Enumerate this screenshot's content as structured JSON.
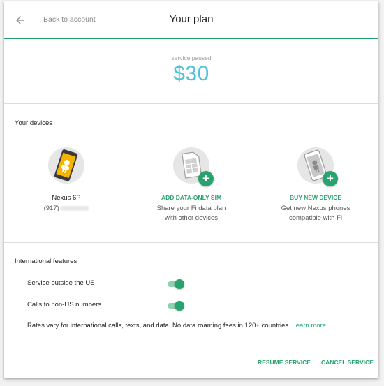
{
  "header": {
    "back_label": "Back to account",
    "title": "Your plan"
  },
  "plan": {
    "status": "service paused",
    "price": "$30"
  },
  "devices": {
    "section_title": "Your devices",
    "owned": {
      "name": "Nexus 6P",
      "number_prefix": "(917)"
    },
    "data_sim": {
      "action": "ADD DATA-ONLY SIM",
      "desc_line1": "Share your Fi data plan",
      "desc_line2": "with other devices"
    },
    "buy_device": {
      "action": "BUY NEW DEVICE",
      "desc_line1": "Get new Nexus phones",
      "desc_line2": "compatible with Fi"
    }
  },
  "international": {
    "section_title": "International features",
    "toggles": [
      {
        "label": "Service outside the US",
        "on": true
      },
      {
        "label": "Calls to non-US numbers",
        "on": true
      }
    ],
    "note": "Rates vary for international calls, texts, and data. No data roaming fees in 120+ countries.",
    "learn_more": "Learn more"
  },
  "footer": {
    "resume": "RESUME SERVICE",
    "cancel": "CANCEL SERVICE"
  },
  "colors": {
    "accent": "#27a46e",
    "price": "#4fc3d8",
    "phone_yellow": "#f4b400"
  },
  "icons": [
    "arrow-back-icon",
    "phone-icon",
    "sim-card-icon",
    "new-phone-icon",
    "plus-icon"
  ]
}
